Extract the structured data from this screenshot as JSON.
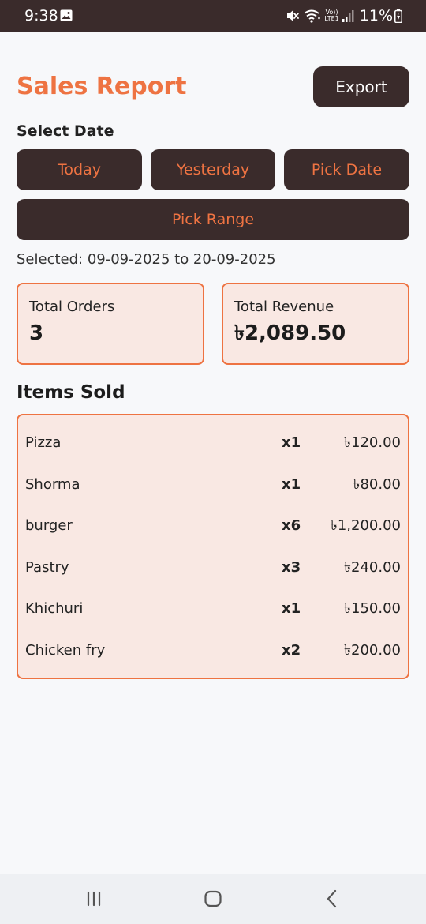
{
  "status_bar": {
    "time": "9:38",
    "battery": "11%",
    "network_label_top": "Vo))",
    "network_label_bottom": "LTE1"
  },
  "header": {
    "title": "Sales Report",
    "export_label": "Export"
  },
  "date_selector": {
    "label": "Select Date",
    "buttons": [
      "Today",
      "Yesterday",
      "Pick Date",
      "Pick Range"
    ],
    "selected_text": "Selected: 09-09-2025 to 20-09-2025"
  },
  "summary": {
    "total_orders_label": "Total Orders",
    "total_orders_value": "3",
    "total_revenue_label": "Total Revenue",
    "total_revenue_value": "৳2,089.50"
  },
  "items_sold": {
    "title": "Items Sold",
    "items": [
      {
        "name": "Pizza",
        "qty": "x1",
        "price": "৳120.00"
      },
      {
        "name": "Shorma",
        "qty": "x1",
        "price": "৳80.00"
      },
      {
        "name": "burger",
        "qty": "x6",
        "price": "৳1,200.00"
      },
      {
        "name": "Pastry",
        "qty": "x3",
        "price": "৳240.00"
      },
      {
        "name": "Khichuri",
        "qty": "x1",
        "price": "৳150.00"
      },
      {
        "name": "Chicken fry",
        "qty": "x2",
        "price": "৳200.00"
      }
    ]
  },
  "colors": {
    "accent": "#ee7342",
    "dark": "#3a2b2b",
    "card_bg": "#f9e8e3",
    "page_bg": "#f7f8fa"
  },
  "nav_icons": [
    "recent-apps-icon",
    "home-icon",
    "back-icon"
  ]
}
